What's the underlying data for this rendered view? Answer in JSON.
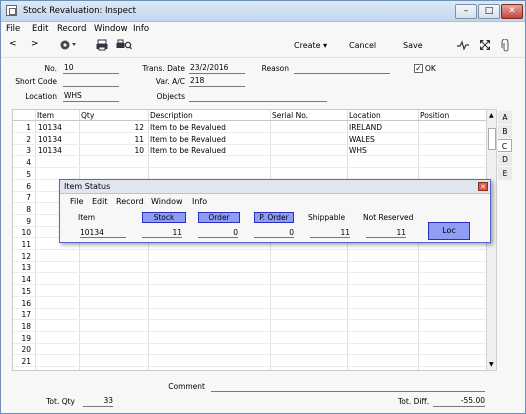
{
  "window": {
    "title": "Stock Revaluation: Inspect"
  },
  "menu": [
    "File",
    "Edit",
    "Record",
    "Window",
    "Info"
  ],
  "toolbar": {
    "create_label": "Create",
    "cancel_label": "Cancel",
    "save_label": "Save"
  },
  "form": {
    "no_label": "No.",
    "no_value": "10",
    "trans_date_label": "Trans. Date",
    "trans_date_value": "23/2/2016",
    "reason_label": "Reason",
    "reason_value": "",
    "ok_label": "OK",
    "ok_checked": true,
    "ok_mark": "✓",
    "short_code_label": "Short Code",
    "short_code_value": "",
    "var_ac_label": "Var. A/C",
    "var_ac_value": "218",
    "location_label": "Location",
    "location_value": "WHS",
    "objects_label": "Objects",
    "objects_value": ""
  },
  "table": {
    "headers": [
      "Item",
      "Qty",
      "Description",
      "Serial No.",
      "Location",
      "Position"
    ],
    "rows": [
      {
        "n": "1",
        "item": "10134",
        "qty": "12",
        "desc": "Item to be Revalued",
        "serial": "",
        "location": "IRELAND",
        "position": ""
      },
      {
        "n": "2",
        "item": "10134",
        "qty": "11",
        "desc": "Item to be Revalued",
        "serial": "",
        "location": "WALES",
        "position": ""
      },
      {
        "n": "3",
        "item": "10134",
        "qty": "10",
        "desc": "Item to be Revalued",
        "serial": "",
        "location": "WHS",
        "position": ""
      },
      {
        "n": "4"
      },
      {
        "n": "5"
      },
      {
        "n": "6"
      },
      {
        "n": "7"
      },
      {
        "n": "8"
      },
      {
        "n": "9"
      },
      {
        "n": "10"
      },
      {
        "n": "11"
      },
      {
        "n": "12"
      },
      {
        "n": "13"
      },
      {
        "n": "14"
      },
      {
        "n": "15"
      },
      {
        "n": "16"
      },
      {
        "n": "17"
      },
      {
        "n": "18"
      },
      {
        "n": "19"
      },
      {
        "n": "20"
      },
      {
        "n": "21"
      }
    ]
  },
  "tabs": [
    "A",
    "B",
    "C",
    "D",
    "E"
  ],
  "selected_tab": "C",
  "footer": {
    "comment_label": "Comment",
    "comment_value": "",
    "tot_qty_label": "Tot. Qty",
    "tot_qty_value": "33",
    "tot_diff_label": "Tot. Diff.",
    "tot_diff_value": "-55.00"
  },
  "item_status": {
    "title": "Item Status",
    "menu": [
      "File",
      "Edit",
      "Record",
      "Window",
      "Info"
    ],
    "item_label": "Item",
    "item_value": "10134",
    "stock_label": "Stock",
    "stock_value": "11",
    "order_label": "Order",
    "order_value": "0",
    "p_order_label": "P. Order",
    "p_order_value": "0",
    "shippable_label": "Shippable",
    "shippable_value": "11",
    "not_reserved_label": "Not Reserved",
    "not_reserved_value": "11",
    "loc_label": "Loc"
  }
}
